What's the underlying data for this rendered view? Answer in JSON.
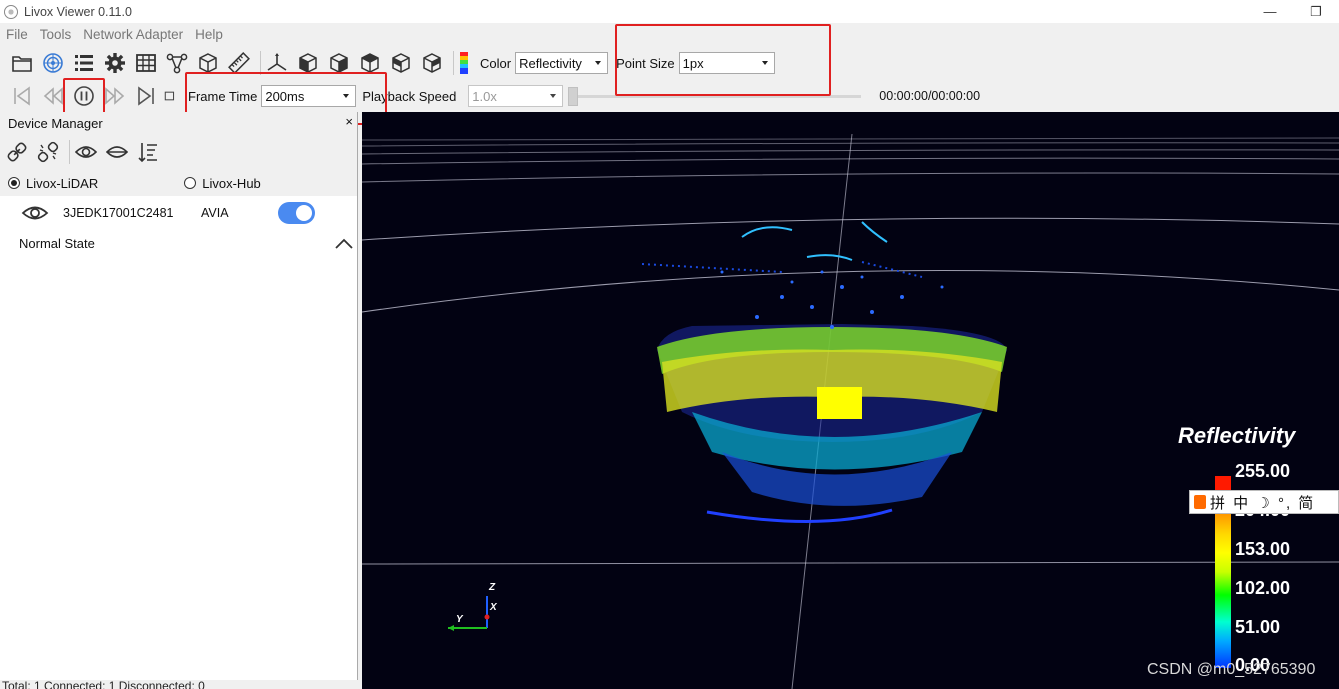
{
  "window": {
    "title": "Livox Viewer 0.11.0",
    "minimize": "—",
    "restore": "❐"
  },
  "menu": {
    "items": [
      "File",
      "Tools",
      "Network Adapter",
      "Help"
    ]
  },
  "toolbar": {
    "color_label": "Color",
    "color_value": "Reflectivity",
    "point_size_label": "Point Size",
    "point_size_value": "1px",
    "frame_time_label": "Frame Time",
    "frame_time_value": "200ms",
    "playback_speed_label": "Playback Speed",
    "playback_speed_value": "1.0x",
    "time_readout": "00:00:00/00:00:00",
    "playback_progress": 0
  },
  "device_manager": {
    "title": "Device Manager",
    "close": "×",
    "radio_lidar": "Livox-LiDAR",
    "radio_hub": "Livox-Hub",
    "selected": "Livox-LiDAR",
    "device": {
      "serial": "3JEDK17001C2481",
      "type": "AVIA",
      "enabled": true
    },
    "state": "Normal State",
    "status": "Total: 1  Connected: 1  Disconnected: 0"
  },
  "viewport": {
    "legend_title": "Reflectivity",
    "colorbar_labels": [
      "255.00",
      "204.00",
      "153.00",
      "102.00",
      "51.00",
      "0.00"
    ],
    "ime_text": "拼 中 ☽ °, 简",
    "watermark": "CSDN @m0_52765390",
    "axis_labels": {
      "z": "Z",
      "x": "X",
      "y": "Y"
    }
  },
  "colors": {
    "accent": "#4a8af0",
    "highlight": "#e02020",
    "viewport_bg": "#020212"
  }
}
